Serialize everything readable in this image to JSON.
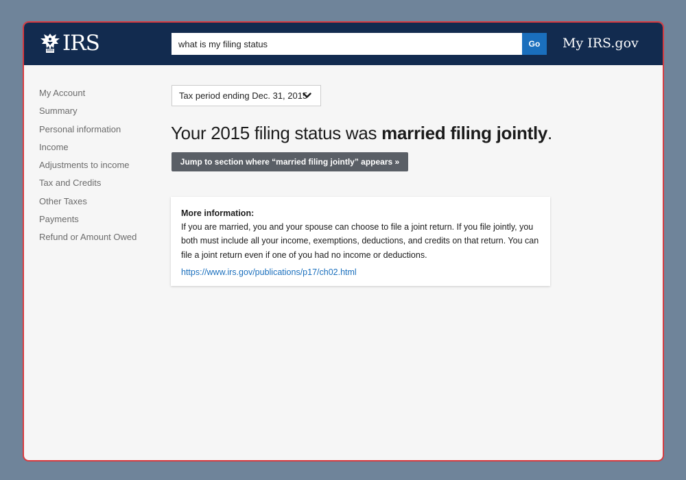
{
  "header": {
    "logo_text": "IRS",
    "search": {
      "value": "what is my filing status",
      "placeholder": ""
    },
    "go_label": "Go",
    "myirs_label": "My IRS.gov"
  },
  "sidebar": {
    "items": [
      {
        "label": "My Account"
      },
      {
        "label": "Summary"
      },
      {
        "label": "Personal information"
      },
      {
        "label": "Income"
      },
      {
        "label": "Adjustments to income"
      },
      {
        "label": "Tax and Credits"
      },
      {
        "label": "Other Taxes"
      },
      {
        "label": "Payments"
      },
      {
        "label": "Refund or Amount Owed"
      }
    ]
  },
  "main": {
    "period_selected": "Tax period ending Dec. 31, 2015",
    "headline_prefix": "Your 2015 filing status was ",
    "headline_status": "married filing jointly",
    "headline_suffix": ".",
    "jump_label": "Jump to section where “married filing jointly” appears »",
    "info": {
      "title": "More information:",
      "body": "If you are married, you and your spouse can choose to file a joint return. If you file jointly, you both must include all your income, exemptions, deductions, and credits on that return. You can file a joint return even if one of you had no income or deductions.",
      "link_text": "https://www.irs.gov/publications/p17/ch02.html"
    }
  },
  "colors": {
    "header_bg": "#122b4f",
    "accent": "#1a6fbd",
    "window_border": "#d83a3f",
    "button_gray": "#5a5f66",
    "page_bg": "#6f849a"
  },
  "icons": {
    "logo": "irs-eagle-icon",
    "dropdown": "chevron-down-icon"
  }
}
